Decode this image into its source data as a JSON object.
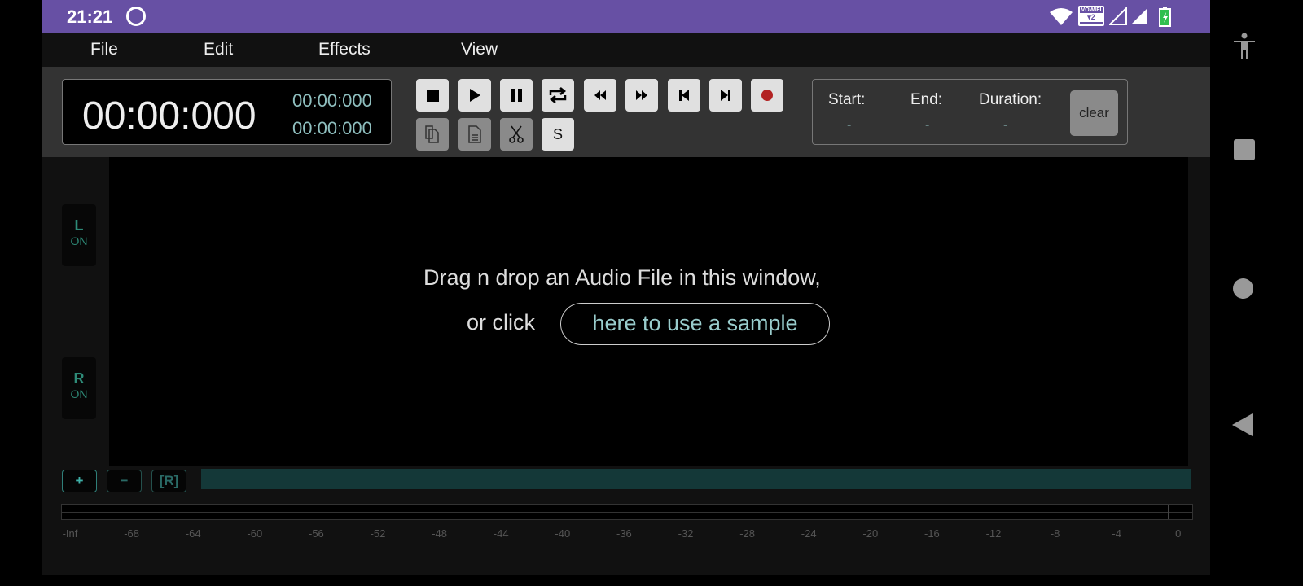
{
  "status_bar": {
    "time": "21:21",
    "vowifi": "VOWIFI",
    "vowifi_sub": "▾2",
    "colors": {
      "bg": "#6750a4"
    }
  },
  "menu": [
    {
      "label": "File"
    },
    {
      "label": "Edit"
    },
    {
      "label": "Effects"
    },
    {
      "label": "View"
    }
  ],
  "timer": {
    "main": "00:00:000",
    "secondary_top": "00:00:000",
    "secondary_bottom": "00:00:000"
  },
  "transport": [
    {
      "name": "stop",
      "icon": "stop-icon"
    },
    {
      "name": "play",
      "icon": "play-icon"
    },
    {
      "name": "pause",
      "icon": "pause-icon"
    },
    {
      "name": "loop",
      "icon": "repeat-icon"
    },
    {
      "name": "rewind",
      "icon": "rewind-icon"
    },
    {
      "name": "fast-forward",
      "icon": "fast-forward-icon"
    },
    {
      "name": "skip-start",
      "icon": "skip-back-icon"
    },
    {
      "name": "skip-end",
      "icon": "skip-forward-icon"
    },
    {
      "name": "record",
      "icon": "record-icon"
    }
  ],
  "edit_tools": [
    {
      "name": "copy",
      "icon": "copy-icon",
      "enabled": false
    },
    {
      "name": "paste",
      "icon": "document-icon",
      "enabled": false
    },
    {
      "name": "cut",
      "icon": "scissors-icon",
      "enabled": false
    },
    {
      "name": "silence",
      "label": "S",
      "enabled": true
    }
  ],
  "selection": {
    "start_label": "Start:",
    "start_value": "-",
    "end_label": "End:",
    "end_value": "-",
    "duration_label": "Duration:",
    "duration_value": "-",
    "clear_label": "clear"
  },
  "channels": [
    {
      "letter": "L",
      "state": "ON"
    },
    {
      "letter": "R",
      "state": "ON"
    }
  ],
  "drop_zone": {
    "line1": "Drag n drop an Audio File in this window,",
    "line2_prefix": "or click",
    "sample_link": "here to use a sample"
  },
  "zoom_controls": {
    "zoom_in": "+",
    "zoom_out": "−",
    "reset": "[R]"
  },
  "meter": {
    "ticks": [
      "-Inf",
      "-68",
      "-64",
      "-60",
      "-56",
      "-52",
      "-48",
      "-44",
      "-40",
      "-36",
      "-32",
      "-28",
      "-24",
      "-20",
      "-16",
      "-12",
      "-8",
      "-4",
      "0"
    ],
    "level": 0
  },
  "colors": {
    "accent": "#2e8b78",
    "record": "#b22222",
    "scrollbar": "#143838"
  }
}
